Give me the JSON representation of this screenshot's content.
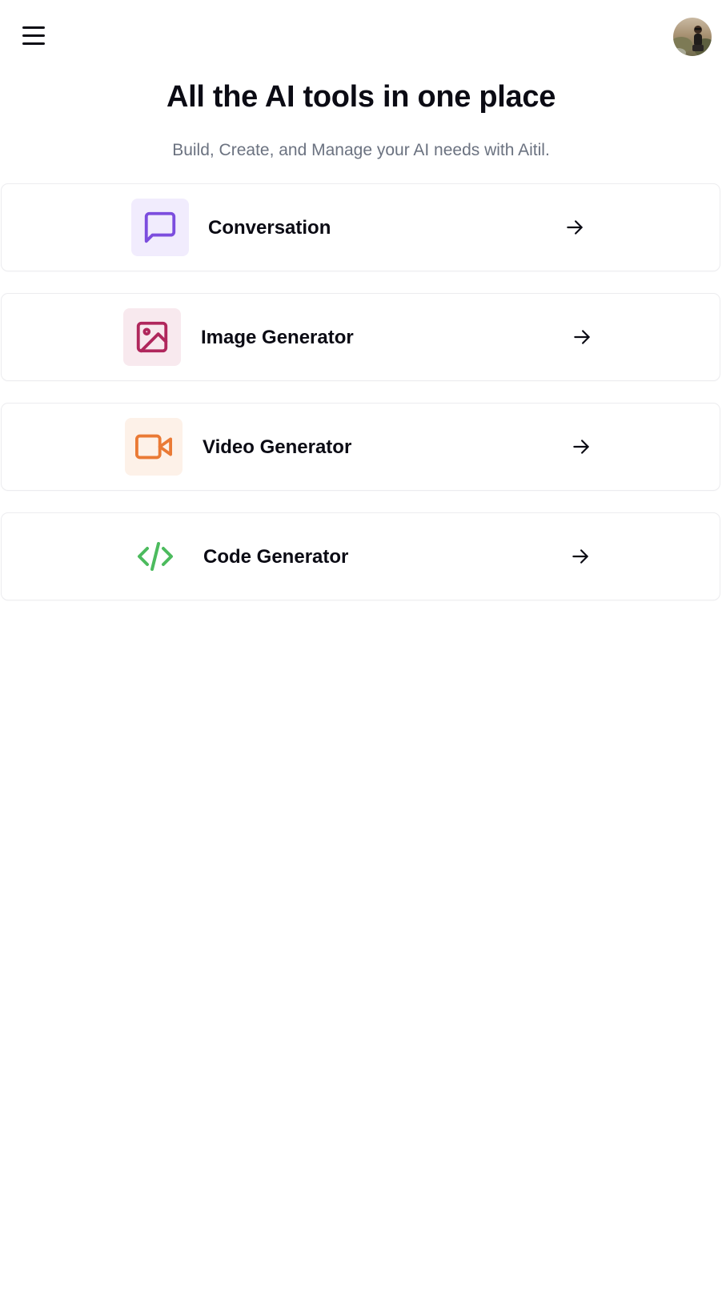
{
  "header": {
    "menu_icon": "hamburger-menu-icon",
    "avatar_icon": "user-avatar"
  },
  "hero": {
    "title": "All the AI tools in one place",
    "subtitle": "Build, Create, and Manage your AI needs with Aitil."
  },
  "tools": [
    {
      "label": "Conversation",
      "icon": "message-square-icon",
      "color": "#7c4dde",
      "bg": "#f1ecfd"
    },
    {
      "label": "Image Generator",
      "icon": "image-icon",
      "color": "#b0275c",
      "bg": "#f8e9ee"
    },
    {
      "label": "Video Generator",
      "icon": "video-icon",
      "color": "#ea7a35",
      "bg": "#fdf1e8"
    },
    {
      "label": "Code Generator",
      "icon": "code-icon",
      "color": "#4cbb5e",
      "bg": "#ffffff"
    }
  ],
  "arrow_icon": "arrow-right-icon"
}
